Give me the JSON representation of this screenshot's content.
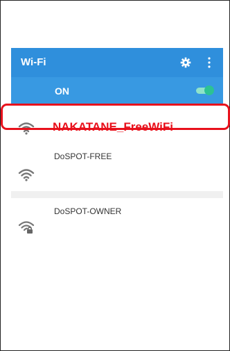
{
  "appbar": {
    "title": "Wi-Fi",
    "settings_icon": "gear-icon",
    "more_icon": "more-vert-icon",
    "color": "#2f8fdc"
  },
  "wifi_state": {
    "label": "ON",
    "enabled": true,
    "toggle_color": "#2cc294"
  },
  "networks": [
    {
      "ssid": "NAKATANE_FreeWiFi",
      "icon": "wifi-icon",
      "locked": false,
      "highlighted": true,
      "highlight_color": "#e8111c"
    },
    {
      "ssid": "DoSPOT-FREE",
      "icon": "wifi-icon",
      "locked": false,
      "highlighted": false
    },
    {
      "ssid": "DoSPOT-OWNER",
      "icon": "wifi-lock-icon",
      "locked": true,
      "highlighted": false
    }
  ]
}
